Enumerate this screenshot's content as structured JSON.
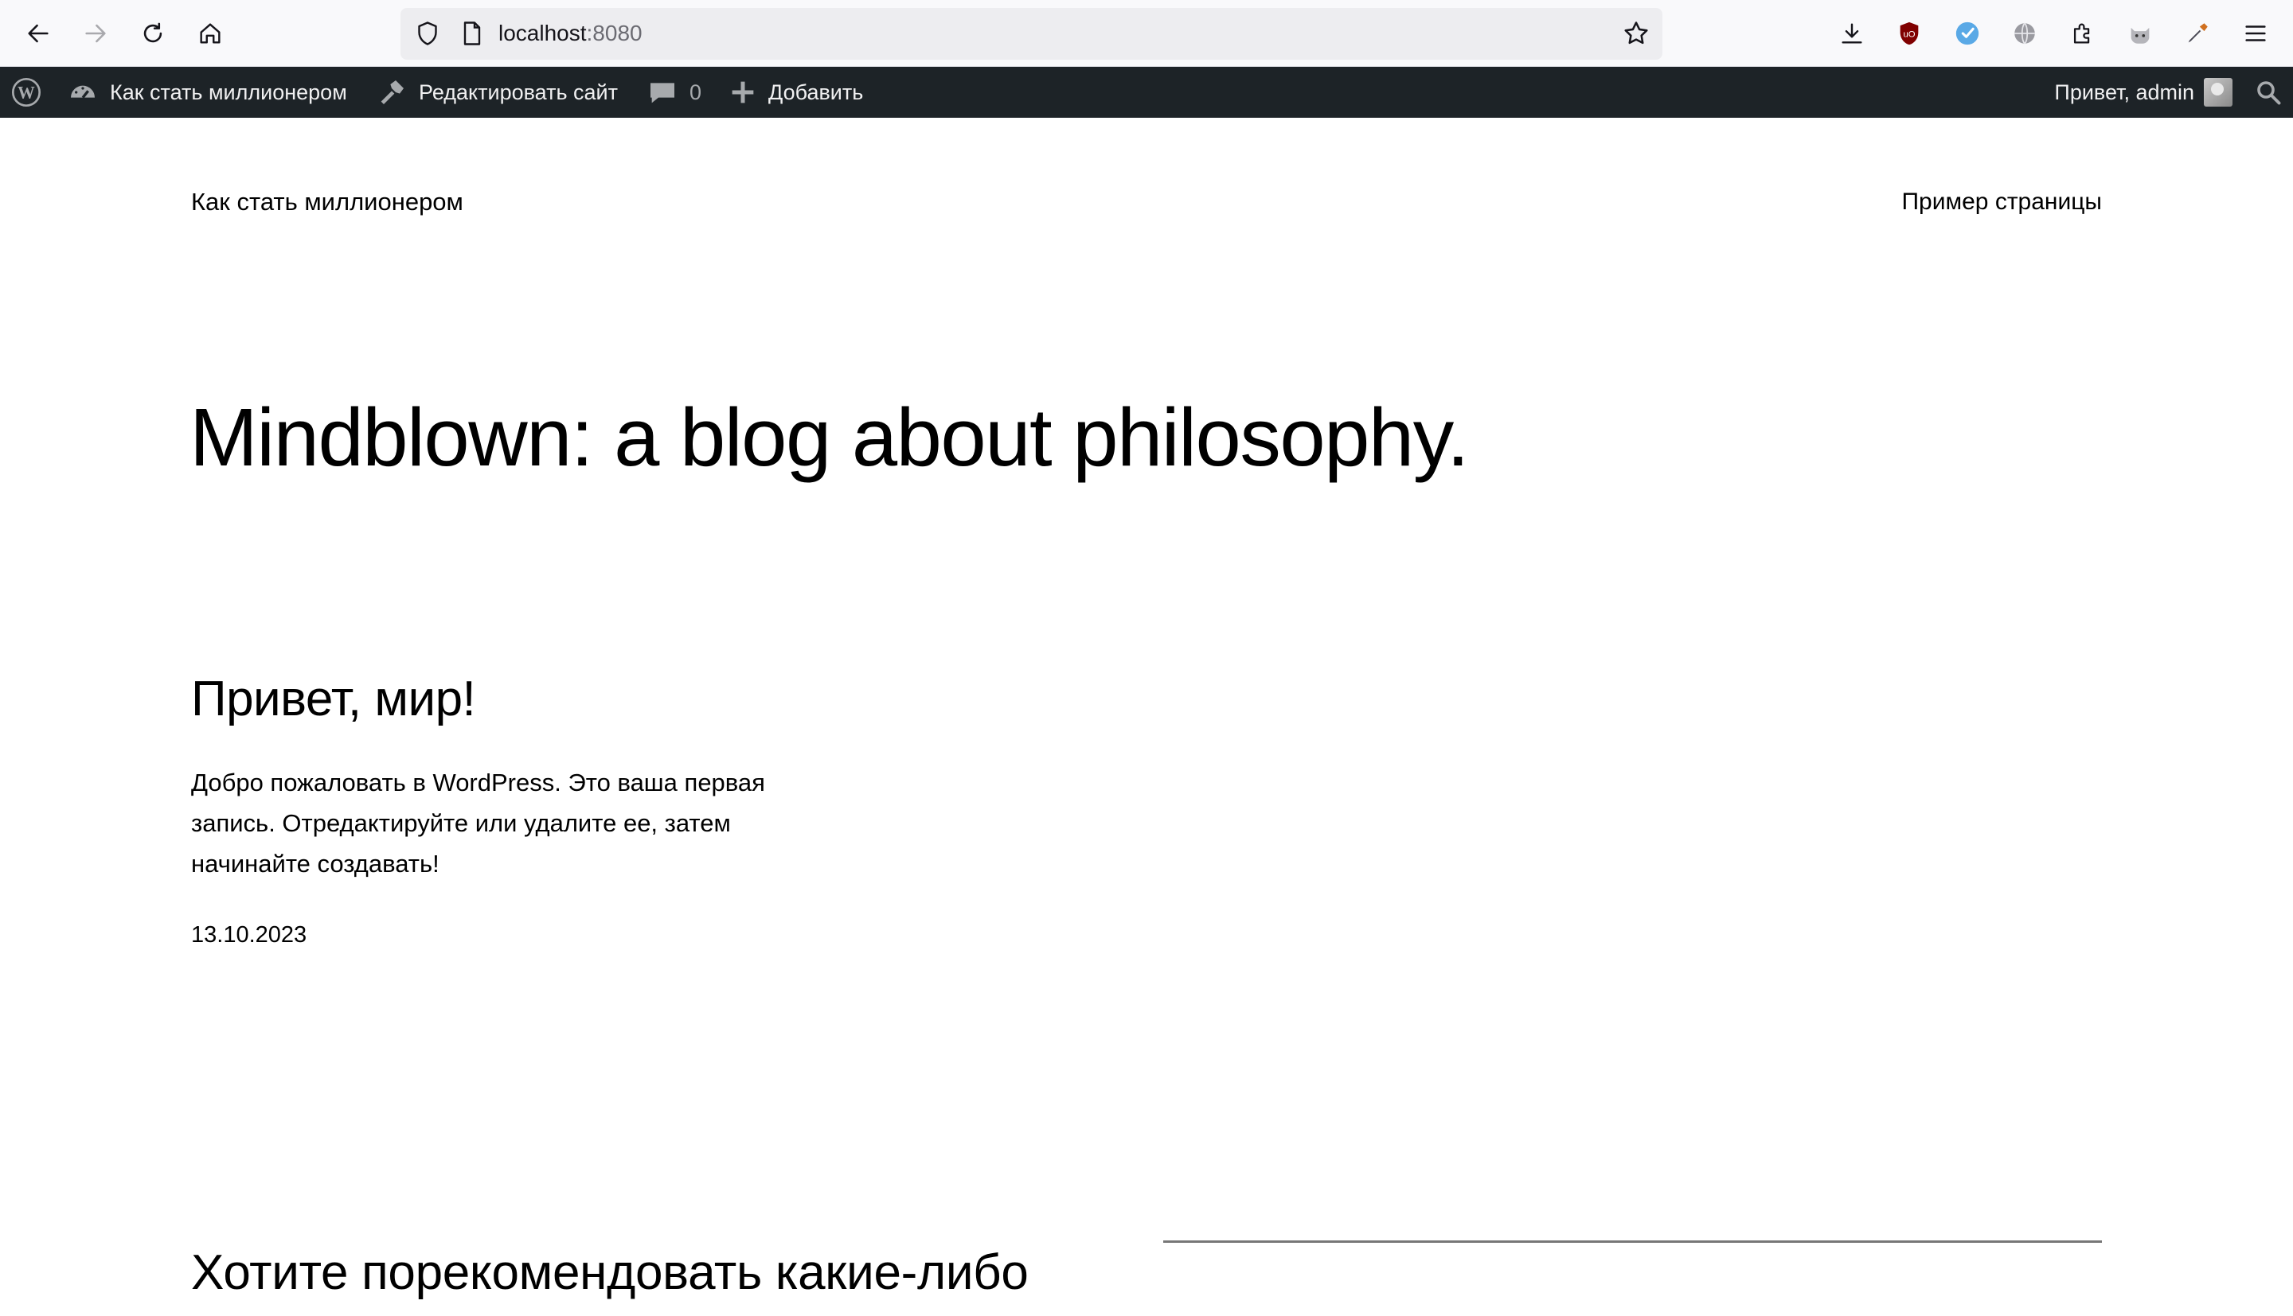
{
  "browser": {
    "url_host": "localhost",
    "url_port": ":8080"
  },
  "admin_bar": {
    "site_name": "Как стать миллионером",
    "edit_site": "Редактировать сайт",
    "comments_count": "0",
    "add_new": "Добавить",
    "greeting": "Привет, admin"
  },
  "site": {
    "title": "Как стать миллионером",
    "nav_page": "Пример страницы"
  },
  "hero": {
    "heading": "Mindblown: a blog about philosophy."
  },
  "post": {
    "title": "Привет, мир!",
    "excerpt": "Добро пожаловать в WordPress. Это ваша первая запись. Отредактируйте или удалите ее, затем начинайте создавать!",
    "date": "13.10.2023"
  },
  "cta": {
    "heading": "Хотите порекомендовать какие-либо"
  },
  "colors": {
    "admin_bar_bg": "#1d2327",
    "browser_bg": "#f9f9fb",
    "url_bar_bg": "#ededf0",
    "ublock_red": "#800000",
    "accent_blue": "#5aa9e6"
  },
  "icons": {
    "back": "arrow-left-icon",
    "forward": "arrow-right-icon",
    "reload": "reload-icon",
    "home": "home-icon",
    "shield": "shield-icon",
    "page": "page-icon",
    "bookmark": "star-icon",
    "downloads": "download-icon",
    "extensions": "puzzle-icon",
    "menu": "hamburger-icon",
    "wp": "wordpress-logo-icon",
    "dashboard": "dashboard-icon",
    "edit": "hammer-icon",
    "comments": "comment-bubble-icon",
    "add": "plus-icon",
    "search": "search-icon"
  }
}
